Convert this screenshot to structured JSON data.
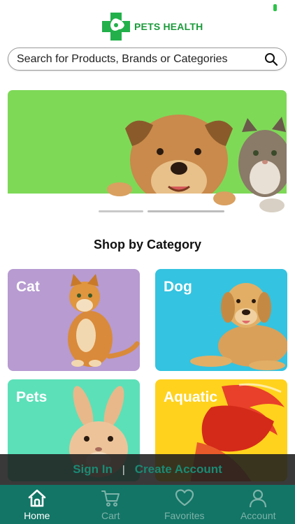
{
  "header": {
    "logo_text": "PETS HEALTH"
  },
  "search": {
    "placeholder": "Search for Products, Brands or Categories",
    "icon": "search-icon"
  },
  "banner": {
    "carousel_count": 2,
    "active_index": 1
  },
  "section": {
    "title": "Shop by Category"
  },
  "categories": [
    {
      "label": "Cat",
      "color": "#b79bd1"
    },
    {
      "label": "Dog",
      "color": "#34c3e0"
    },
    {
      "label": "Pets",
      "color": "#5ce0b8"
    },
    {
      "label": "Aquatic",
      "color": "#ffd21e"
    }
  ],
  "auth": {
    "sign_in": "Sign In",
    "separator": "|",
    "create_account": "Create Account"
  },
  "tabbar": {
    "items": [
      {
        "label": "Home",
        "icon": "home-icon",
        "active": true
      },
      {
        "label": "Cart",
        "icon": "cart-icon",
        "active": false
      },
      {
        "label": "Favorites",
        "icon": "heart-icon",
        "active": false
      },
      {
        "label": "Account",
        "icon": "person-icon",
        "active": false
      }
    ]
  },
  "colors": {
    "brand_green": "#1a9a3a",
    "tab_bar": "#127566",
    "auth_link": "#1a8a74"
  }
}
